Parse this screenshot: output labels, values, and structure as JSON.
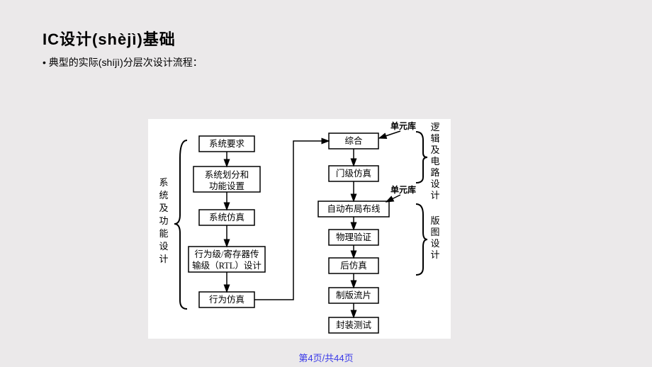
{
  "title": "IC设计(shèjì)基础",
  "bullet": "• 典型的实际(shíjì)分层次设计流程：",
  "footer": "第4页/共44页",
  "chart_data": {
    "type": "flow-diagram",
    "left_column": [
      "系统要求",
      "系统划分和功能设置",
      "系统仿真",
      "行为级/寄存器传输级（RTL）设计",
      "行为仿真"
    ],
    "right_column": [
      "综合",
      "门级仿真",
      "自动布局布线",
      "物理验证",
      "后仿真",
      "制版流片",
      "封装测试"
    ],
    "left_group_label": "系统及功能设计",
    "right_group_top_label": "逻辑及电路设计",
    "right_group_bottom_label": "版图设计",
    "annotations": [
      "单元库",
      "单元库"
    ],
    "flow": "top-down within each column; 行为仿真 -> 综合 (cross); annotations point to 综合 and 自动布局布线"
  }
}
